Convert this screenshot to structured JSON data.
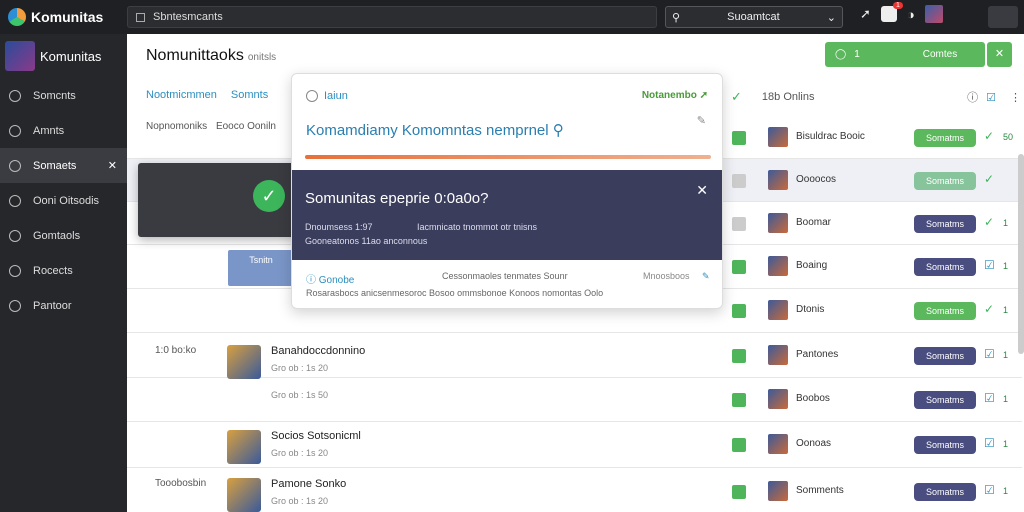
{
  "app": {
    "name": "Komunitas"
  },
  "topbar": {
    "search_placeholder": "Sbntesmcants",
    "search2_value": "Suoamtcat",
    "notif_count": "1"
  },
  "sidebar": {
    "brand": "Komunitas",
    "items": [
      {
        "label": "Somcnts",
        "icon": "circle-icon"
      },
      {
        "label": "Amnts",
        "icon": "folder-icon"
      },
      {
        "label": "Somaets",
        "icon": "group-icon",
        "active": true
      },
      {
        "label": "Ooni Oitsodis",
        "icon": "chat-icon"
      },
      {
        "label": "Gomtaols",
        "icon": "card-icon"
      },
      {
        "label": "Rocects",
        "icon": "trophy-icon"
      },
      {
        "label": "Pantoor",
        "icon": "settings-icon"
      }
    ]
  },
  "main": {
    "title": "Nomunittaoks",
    "title_sub": "onitsls",
    "green_button": "Comtes",
    "green_button_count": "1",
    "tabs": [
      "Nootmicmmen",
      "Somnts"
    ],
    "col_head": "18b  Onlins",
    "sub_left": "Nopnomoniks",
    "sub_left2": "Eooco Ooniln"
  },
  "rows": [
    {
      "name": "Bisuldrac Booic",
      "num": "50",
      "action": "Somatms",
      "variant": "green",
      "check": true
    },
    {
      "name": "Oooocos",
      "num": "",
      "action": "Somatms",
      "variant": "green light",
      "check": false
    },
    {
      "name": "Boomar",
      "num": "1",
      "action": "Somatms",
      "variant": "slate",
      "check": false
    },
    {
      "name": "Boaing",
      "num": "1",
      "action": "Somatms",
      "variant": "slate",
      "check": true
    },
    {
      "name": "Dtonis",
      "num": "1",
      "action": "Somatms",
      "variant": "green",
      "check": true
    },
    {
      "name": "Pantones",
      "num": "1",
      "action": "Somatms",
      "variant": "slate",
      "check": true
    },
    {
      "name": "Boobos",
      "num": "1",
      "action": "Somatms",
      "variant": "slate",
      "check": true
    },
    {
      "name": "Oonoas",
      "num": "1",
      "action": "Somatms",
      "variant": "slate",
      "check": true
    },
    {
      "name": "Somments",
      "num": "1",
      "action": "Somatms",
      "variant": "slate",
      "check": true
    }
  ],
  "left_items": [
    {
      "label": "1:0 bo:ko",
      "title": "Banahdoccdonnino",
      "sub": "Gro ob :  1s 20"
    },
    {
      "label": "",
      "title": "",
      "sub": "Gro ob :  1s 50"
    },
    {
      "label": "",
      "title": "Socios Sotsonicml",
      "sub": "Gro ob :  1s 20"
    },
    {
      "label": "Tooobosbin",
      "title": "Pamone Sonko",
      "sub": "Gro ob :  1s 20"
    }
  ],
  "dark_card": {
    "chip": "Tsnitn"
  },
  "popup": {
    "search": "Iaiun",
    "badge": "Notanembo",
    "title": "Komamdiamy Komomntas nemprnel",
    "question": "Somunitas epeprie 0:0a0o?",
    "meta1": "Dnoumsess 1:97",
    "meta2": "Iacmnicato tnommot otr tnisns",
    "meta3": "Gooneatonos 11ao anconnous",
    "foot_left": "Gonobe",
    "foot_mid": "Cessonmaoles tenmates Sounr",
    "foot_right": "Mnoosboos",
    "foot_line": "Rosarasbocs anicsenmesoroc Bosoo ommsbonoe Konoos nomontas Oolo"
  }
}
